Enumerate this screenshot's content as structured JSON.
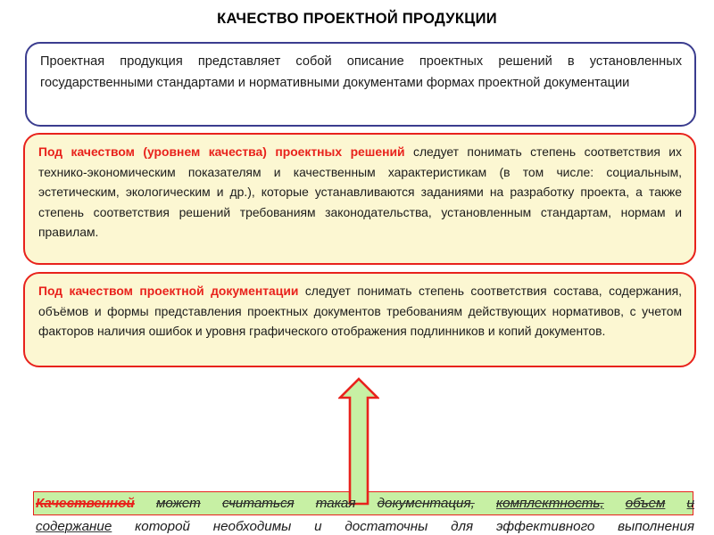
{
  "slide": {
    "title": "КАЧЕСТВО ПРОЕКТНОЙ ПРОДУКЦИИ"
  },
  "colors": {
    "title_text": "#000000",
    "blue_box_border": "#3b3d8f",
    "blue_box_fill": "#ffffff",
    "red_box_border": "#e8221c",
    "yellow_box_fill": "#fcf7d2",
    "green_box_fill": "#c7f0a4",
    "arrow_fill": "#c7f0a4",
    "arrow_border": "#e8221c",
    "accent_red": "#e8221c",
    "body_text": "#1b1b1b"
  },
  "boxes": {
    "definition": {
      "text": "Проектная продукция представляет собой описание проектных решений в установленных государственными стандартами и нормативными документами формах проектной документации"
    },
    "quality_of_solutions": {
      "lead": "Под качеством (уровнем качества) проектных решений",
      "body": " следует понимать степень соответствия их технико-экономическим показателям и качественным характеристикам (в том числе: социальным, эстетическим, экологическим и др.), которые устанавливаются заданиями на разработку проекта, а также степень соответствия решений требованиям законодательства, установленным стандартам, нормам и правилам."
    },
    "quality_of_documentation": {
      "lead": "Под качеством проектной документации",
      "body": " следует понимать степень соответствия состава, содержания, объёмов и формы представления проектных документов требованиям действующих нормативов, с учетом факторов наличия ошибок и уровня графического отображения подлинников и копий документов."
    }
  },
  "bottom": {
    "line1": {
      "struck_red": "Качественной",
      "segment_a": "может",
      "segment_b": "считаться",
      "segment_c": "такая",
      "segment_d": "документация,",
      "segment_e": "комплектность,",
      "segment_f": "объем",
      "segment_g": "и"
    },
    "line2": {
      "underlined": "содержание",
      "rest_a": "которой",
      "rest_b": "необходимы",
      "rest_c": "и",
      "rest_d": "достаточны",
      "rest_e": "для",
      "rest_f": "эффективного",
      "rest_g": "выполнения"
    }
  },
  "arrow": {
    "name": "up-arrow",
    "direction": "up"
  }
}
